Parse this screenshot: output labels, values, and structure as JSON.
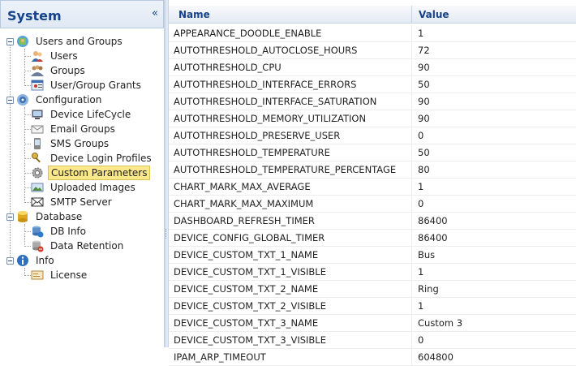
{
  "panel": {
    "title": "System",
    "collapse_glyph": "«"
  },
  "tree": {
    "users_and_groups": {
      "label": "Users and Groups",
      "icon": "users-and-groups-icon"
    },
    "users": {
      "label": "Users",
      "icon": "user-icon"
    },
    "groups": {
      "label": "Groups",
      "icon": "groups-icon"
    },
    "grants": {
      "label": "User/Group Grants",
      "icon": "grants-icon"
    },
    "configuration": {
      "label": "Configuration",
      "icon": "configuration-icon"
    },
    "lifecycle": {
      "label": "Device LifeCycle",
      "icon": "lifecycle-icon"
    },
    "email_groups": {
      "label": "Email Groups",
      "icon": "email-icon"
    },
    "sms_groups": {
      "label": "SMS Groups",
      "icon": "sms-icon"
    },
    "login_profiles": {
      "label": "Device Login Profiles",
      "icon": "login-profiles-icon"
    },
    "custom_parameters": {
      "label": "Custom Parameters",
      "icon": "gear-icon",
      "selected": true
    },
    "uploaded_images": {
      "label": "Uploaded Images",
      "icon": "images-icon"
    },
    "smtp_server": {
      "label": "SMTP Server",
      "icon": "smtp-icon"
    },
    "database": {
      "label": "Database",
      "icon": "database-icon"
    },
    "db_info": {
      "label": "DB Info",
      "icon": "db-info-icon"
    },
    "data_retention": {
      "label": "Data Retention",
      "icon": "data-retention-icon"
    },
    "info": {
      "label": "Info",
      "icon": "info-icon"
    },
    "license": {
      "label": "License",
      "icon": "license-icon"
    }
  },
  "grid": {
    "columns": {
      "name": "Name",
      "value": "Value"
    },
    "rows": [
      {
        "name": "APPEARANCE_DOODLE_ENABLE",
        "value": "1"
      },
      {
        "name": "AUTOTHRESHOLD_AUTOCLOSE_HOURS",
        "value": "72"
      },
      {
        "name": "AUTOTHRESHOLD_CPU",
        "value": "90"
      },
      {
        "name": "AUTOTHRESHOLD_INTERFACE_ERRORS",
        "value": "50"
      },
      {
        "name": "AUTOTHRESHOLD_INTERFACE_SATURATION",
        "value": "90"
      },
      {
        "name": "AUTOTHRESHOLD_MEMORY_UTILIZATION",
        "value": "90"
      },
      {
        "name": "AUTOTHRESHOLD_PRESERVE_USER",
        "value": "0"
      },
      {
        "name": "AUTOTHRESHOLD_TEMPERATURE",
        "value": "50"
      },
      {
        "name": "AUTOTHRESHOLD_TEMPERATURE_PERCENTAGE",
        "value": "80"
      },
      {
        "name": "CHART_MARK_MAX_AVERAGE",
        "value": "1"
      },
      {
        "name": "CHART_MARK_MAX_MAXIMUM",
        "value": "0"
      },
      {
        "name": "DASHBOARD_REFRESH_TIMER",
        "value": "86400"
      },
      {
        "name": "DEVICE_CONFIG_GLOBAL_TIMER",
        "value": "86400"
      },
      {
        "name": "DEVICE_CUSTOM_TXT_1_NAME",
        "value": "Bus"
      },
      {
        "name": "DEVICE_CUSTOM_TXT_1_VISIBLE",
        "value": "1"
      },
      {
        "name": "DEVICE_CUSTOM_TXT_2_NAME",
        "value": "Ring"
      },
      {
        "name": "DEVICE_CUSTOM_TXT_2_VISIBLE",
        "value": "1"
      },
      {
        "name": "DEVICE_CUSTOM_TXT_3_NAME",
        "value": "Custom 3"
      },
      {
        "name": "DEVICE_CUSTOM_TXT_3_VISIBLE",
        "value": "0"
      },
      {
        "name": "IPAM_ARP_TIMEOUT",
        "value": "604800"
      }
    ]
  }
}
